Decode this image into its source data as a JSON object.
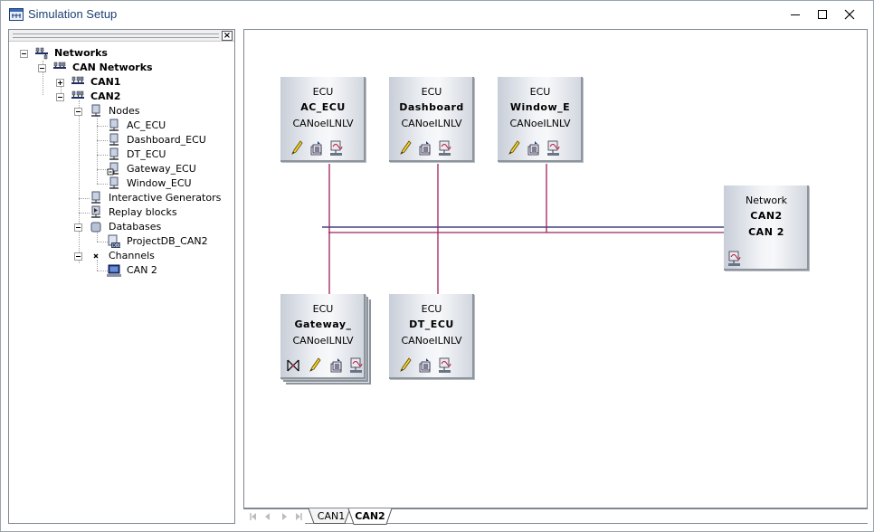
{
  "window": {
    "title": "Simulation Setup",
    "icon": "network-window-icon",
    "controls": {
      "minimize": "minimize-icon",
      "maximize": "maximize-icon",
      "close": "close-icon"
    }
  },
  "tree": {
    "close_glyph": "×",
    "items": [
      {
        "label": "Networks",
        "icon": "networks-icon",
        "expanded": true
      },
      {
        "label": "CAN Networks",
        "icon": "can-networks-icon",
        "expanded": true
      },
      {
        "label": "CAN1",
        "icon": "can-bus-icon",
        "expanded": false
      },
      {
        "label": "CAN2",
        "icon": "can-bus-icon",
        "expanded": true
      },
      {
        "label": "Nodes",
        "icon": "node-icon",
        "expanded": true
      },
      {
        "label": "AC_ECU",
        "icon": "node-icon"
      },
      {
        "label": "Dashboard_ECU",
        "icon": "node-icon"
      },
      {
        "label": "DT_ECU",
        "icon": "node-icon"
      },
      {
        "label": "Gateway_ECU",
        "icon": "gateway-node-icon"
      },
      {
        "label": "Window_ECU",
        "icon": "node-icon"
      },
      {
        "label": "Interactive Generators",
        "icon": "generator-icon"
      },
      {
        "label": "Replay blocks",
        "icon": "replay-icon"
      },
      {
        "label": "Databases",
        "icon": "database-icon",
        "expanded": true
      },
      {
        "label": "ProjectDB_CAN2",
        "icon": "dbc-file-icon"
      },
      {
        "label": "Channels",
        "icon": "channel-icon",
        "expanded": true
      },
      {
        "label": "CAN 2",
        "icon": "can-channel-icon"
      }
    ]
  },
  "canvas": {
    "ecus": [
      {
        "type": "ECU",
        "name": "AC_ECU",
        "layer": "CANoeILNLV",
        "icons": [
          "pencil-icon",
          "cnode-icon",
          "network-node-icon"
        ]
      },
      {
        "type": "ECU",
        "name": "Dashboard",
        "layer": "CANoeILNLV",
        "icons": [
          "pencil-icon",
          "cnode-icon",
          "network-node-icon"
        ]
      },
      {
        "type": "ECU",
        "name": "Window_E",
        "layer": "CANoeILNLV",
        "icons": [
          "pencil-icon",
          "cnode-icon",
          "network-node-icon"
        ]
      },
      {
        "type": "ECU",
        "name": "Gateway_",
        "layer": "CANoeILNLV",
        "icons": [
          "gateway-icon",
          "pencil-icon",
          "cnode-icon",
          "network-node-icon"
        ]
      },
      {
        "type": "ECU",
        "name": "DT_ECU",
        "layer": "CANoeILNLV",
        "icons": [
          "pencil-icon",
          "cnode-icon",
          "network-node-icon"
        ]
      }
    ],
    "network": {
      "type": "Network",
      "name": "CAN2",
      "channel": "CAN 2",
      "icon": "network-node-icon"
    },
    "colors": {
      "bus_main": "#1f1f6b",
      "bus_stub": "#a0205a"
    }
  },
  "tabs": {
    "nav": [
      "first-icon",
      "prev-icon",
      "next-icon",
      "last-icon"
    ],
    "items": [
      {
        "label": "CAN1",
        "active": false
      },
      {
        "label": "CAN2",
        "active": true
      }
    ]
  }
}
